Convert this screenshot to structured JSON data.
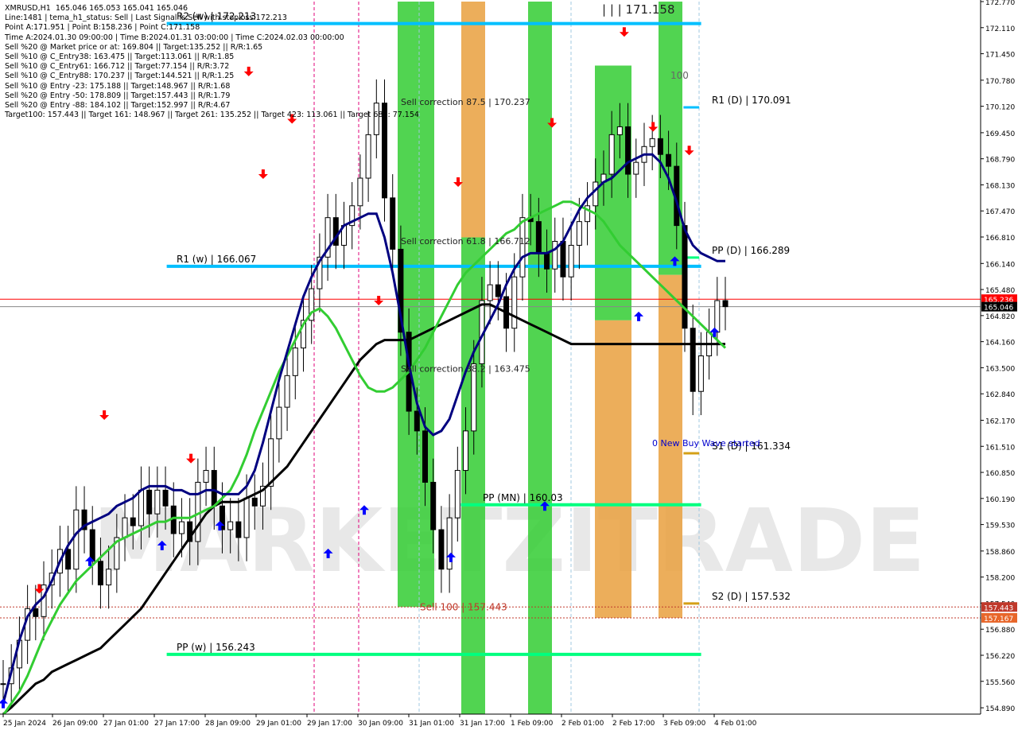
{
  "colors": {
    "background": "#ffffff",
    "axis_text": "#000000",
    "zone_green": "#32cd32",
    "zone_orange": "#e9a03e",
    "level_blue": "#00bfff",
    "level_green": "#00ff7f",
    "ma_fast": "#000080",
    "ma_mid": "#32cd32",
    "ma_slow": "#000000",
    "arrow_up": "#0000ff",
    "arrow_down": "#ff0000",
    "price_line_red": "#ff0000",
    "sell_line": "#c0392b",
    "watermark": "#d9d9d9"
  },
  "info_panel": [
    "XMRUSD,H1  165.046 165.053 165.041 165.046",
    "Line:1481 | tema_h1_status: Sell | Last Signal is:Sell with stoploss:172.213",
    "Point A:171.951 | Point B:158.236 | Point C:171.158",
    "Time A:2024.01.30 09:00:00 | Time B:2024.01.31 03:00:00 | Time C:2024.02.03 00:00:00",
    "Sell %20 @ Market price or at: 169.804 || Target:135.252 || R/R:1.65",
    "Sell %10 @ C_Entry38: 163.475 || Target:113.061 || R/R:1.85",
    "Sell %10 @ C_Entry61: 166.712 || Target:77.154 || R/R:3.72",
    "Sell %10 @ C_Entry88: 170.237 || Target:144.521 || R/R:1.25",
    "Sell %10 @ Entry -23: 175.188 || Target:148.967 || R/R:1.68",
    "Sell %20 @ Entry -50: 178.809 || Target:157.443 || R/R:1.79",
    "Sell %20 @ Entry -88: 184.102 || Target:152.997 || R/R:4.67",
    "Target100: 157.443 || Target 161: 148.967 || Target 261: 135.252 || Target 423: 113.061 || Target 685: 77.154"
  ],
  "watermark": "MARKETZITRADE",
  "chart_data": {
    "type": "candlestick",
    "symbol": "XMRUSD",
    "timeframe": "H1",
    "ylim": [
      154.73,
      172.77
    ],
    "y_ticks": [
      "172.770",
      "172.110",
      "171.450",
      "170.780",
      "170.120",
      "169.450",
      "168.790",
      "168.130",
      "167.470",
      "166.810",
      "166.140",
      "165.480",
      "164.820",
      "164.160",
      "163.500",
      "162.840",
      "162.170",
      "161.510",
      "160.850",
      "160.190",
      "159.530",
      "158.860",
      "158.200",
      "157.540",
      "156.880",
      "156.220",
      "155.560",
      "154.890"
    ],
    "x_ticks": [
      "25 Jan 2024",
      "26 Jan 09:00",
      "27 Jan 01:00",
      "27 Jan 17:00",
      "28 Jan 09:00",
      "29 Jan 01:00",
      "29 Jan 17:00",
      "30 Jan 09:00",
      "31 Jan 01:00",
      "31 Jan 17:00",
      "1 Feb 09:00",
      "2 Feb 01:00",
      "2 Feb 17:00",
      "3 Feb 09:00",
      "4 Feb 01:00"
    ],
    "current_price": "165.046",
    "last_price_tag": "165.236",
    "price_tags": [
      {
        "value": 157.443,
        "label": "157.443"
      },
      {
        "value": 157.167,
        "label": "157.167"
      }
    ],
    "levels": [
      {
        "label": "R2 (w) | 172.213",
        "value": 172.213,
        "color": "level_blue",
        "x_from": 0.17,
        "x_to": 0.715
      },
      {
        "label": "R1 (w) | 166.067",
        "value": 166.067,
        "color": "level_blue",
        "x_from": 0.17,
        "x_to": 0.715
      },
      {
        "label": "PP (w) | 156.243",
        "value": 156.243,
        "color": "level_green",
        "x_from": 0.17,
        "x_to": 0.715
      },
      {
        "label": "PP (MN) | 160.03",
        "value": 160.03,
        "color": "level_green",
        "x_from": 0.47,
        "x_to": 0.715
      },
      {
        "label": "R1 (D) | 170.091",
        "value": 170.091,
        "color": "level_blue",
        "x_from": 0.697,
        "x_to": 0.713
      },
      {
        "label": "PP (D) | 166.289",
        "value": 166.289,
        "color": "level_green",
        "x_from": 0.697,
        "x_to": 0.713
      },
      {
        "label": "S1 (D) | 161.334",
        "value": 161.334,
        "color": "orange",
        "x_from": 0.697,
        "x_to": 0.713
      },
      {
        "label": "S2 (D) | 157.532",
        "value": 157.532,
        "color": "orange",
        "x_from": 0.697,
        "x_to": 0.713
      }
    ],
    "annotations": [
      {
        "text": "Sell correction 87.5 | 170.237",
        "value": 170.237
      },
      {
        "text": "Sell correction 61.8 | 166.712",
        "value": 166.712
      },
      {
        "text": "Sell correction 38.2 | 163.475",
        "value": 163.475
      },
      {
        "text": "Sell 100 | 157.443",
        "value": 157.443
      },
      {
        "text": "0 New Buy Wave started",
        "value": 161.6
      },
      {
        "text": "| | | 171.158",
        "value": 172.55
      },
      {
        "text": "100",
        "value": 170.9
      }
    ],
    "zones": [
      {
        "color": "zone_green",
        "from": 172.77,
        "to": 157.443
      },
      {
        "color": "zone_orange",
        "from": 172.77,
        "to": 166.8
      },
      {
        "color": "zone_green",
        "from": 166.8,
        "to": 154.73
      },
      {
        "color": "zone_green",
        "from": 172.77,
        "to": 154.73
      },
      {
        "color": "zone_green",
        "from": 171.15,
        "to": 164.7
      },
      {
        "color": "zone_orange",
        "from": 164.7,
        "to": 157.167
      },
      {
        "color": "zone_green",
        "from": 172.77,
        "to": 165.85
      },
      {
        "color": "zone_orange",
        "from": 165.85,
        "to": 157.167
      }
    ],
    "prices": [
      155.5,
      155.9,
      156.6,
      157.4,
      157.2,
      158.0,
      158.3,
      158.9,
      158.4,
      159.9,
      159.4,
      158.6,
      158.0,
      158.4,
      159.2,
      159.7,
      159.5,
      160.4,
      159.8,
      160.4,
      160.0,
      159.3,
      159.6,
      159.1,
      160.6,
      160.9,
      160.0,
      159.4,
      159.6,
      159.2,
      160.2,
      160.0,
      160.5,
      161.7,
      162.5,
      163.3,
      164.0,
      164.7,
      165.5,
      166.3,
      167.3,
      166.6,
      167.1,
      167.6,
      168.3,
      169.4,
      170.2,
      167.8,
      166.5,
      164.4,
      162.4,
      161.9,
      160.6,
      159.4,
      158.4,
      159.7,
      160.9,
      161.9,
      163.6,
      165.2,
      165.6,
      165.3,
      164.5,
      165.8,
      167.3,
      167.2,
      166.4,
      166.0,
      166.7,
      165.8,
      166.6,
      167.2,
      167.6,
      168.2,
      168.4,
      169.4,
      169.6,
      168.4,
      168.7,
      169.1,
      169.3,
      168.9,
      168.6,
      167.1,
      164.5,
      162.9,
      163.8,
      164.4,
      165.2,
      165.046
    ],
    "ma_fast": [
      155.0,
      155.8,
      156.6,
      157.2,
      157.5,
      157.7,
      158.1,
      158.6,
      159.0,
      159.3,
      159.5,
      159.6,
      159.7,
      159.8,
      160.0,
      160.1,
      160.2,
      160.4,
      160.5,
      160.5,
      160.5,
      160.4,
      160.4,
      160.3,
      160.3,
      160.4,
      160.4,
      160.3,
      160.3,
      160.3,
      160.5,
      160.9,
      161.6,
      162.4,
      163.2,
      163.9,
      164.6,
      165.3,
      165.8,
      166.2,
      166.5,
      166.8,
      167.1,
      167.2,
      167.3,
      167.4,
      167.4,
      166.8,
      165.9,
      164.8,
      163.6,
      162.6,
      162.0,
      161.8,
      161.9,
      162.2,
      162.8,
      163.4,
      163.9,
      164.3,
      164.7,
      165.1,
      165.6,
      166.0,
      166.3,
      166.4,
      166.4,
      166.4,
      166.5,
      166.7,
      167.1,
      167.5,
      167.8,
      168.0,
      168.2,
      168.3,
      168.5,
      168.7,
      168.8,
      168.9,
      168.9,
      168.7,
      168.3,
      167.7,
      167.0,
      166.6,
      166.4,
      166.3,
      166.2,
      166.2
    ],
    "ma_mid": [
      154.7,
      155.0,
      155.3,
      155.7,
      156.2,
      156.7,
      157.1,
      157.5,
      157.8,
      158.1,
      158.3,
      158.5,
      158.7,
      158.9,
      159.1,
      159.2,
      159.3,
      159.4,
      159.5,
      159.6,
      159.6,
      159.7,
      159.7,
      159.7,
      159.8,
      159.9,
      160.0,
      160.2,
      160.4,
      160.8,
      161.3,
      161.9,
      162.4,
      162.9,
      163.4,
      163.8,
      164.2,
      164.6,
      164.9,
      165.0,
      164.8,
      164.5,
      164.1,
      163.7,
      163.3,
      163.0,
      162.9,
      162.9,
      163.0,
      163.2,
      163.4,
      163.7,
      164.0,
      164.4,
      164.8,
      165.2,
      165.6,
      165.9,
      166.1,
      166.3,
      166.5,
      166.7,
      166.9,
      167.0,
      167.2,
      167.3,
      167.4,
      167.5,
      167.6,
      167.7,
      167.7,
      167.6,
      167.5,
      167.4,
      167.2,
      166.9,
      166.6,
      166.4,
      166.2,
      166.0,
      165.8,
      165.6,
      165.4,
      165.2,
      165.0,
      164.8,
      164.6,
      164.4,
      164.2,
      164.0
    ],
    "ma_slow": [
      154.73,
      154.9,
      155.1,
      155.3,
      155.5,
      155.6,
      155.8,
      155.9,
      156.0,
      156.1,
      156.2,
      156.3,
      156.4,
      156.6,
      156.8,
      157.0,
      157.2,
      157.4,
      157.7,
      158.0,
      158.3,
      158.6,
      158.9,
      159.2,
      159.5,
      159.8,
      160.0,
      160.1,
      160.1,
      160.1,
      160.2,
      160.3,
      160.4,
      160.6,
      160.8,
      161.0,
      161.3,
      161.6,
      161.9,
      162.2,
      162.5,
      162.8,
      163.1,
      163.4,
      163.7,
      163.9,
      164.1,
      164.2,
      164.2,
      164.2,
      164.2,
      164.3,
      164.4,
      164.5,
      164.6,
      164.7,
      164.8,
      164.9,
      165.0,
      165.1,
      165.1,
      165.0,
      164.9,
      164.8,
      164.7,
      164.6,
      164.5,
      164.4,
      164.3,
      164.2,
      164.1,
      164.1,
      164.1,
      164.1,
      164.1,
      164.1,
      164.1,
      164.1,
      164.1,
      164.1,
      164.1,
      164.1,
      164.1,
      164.1,
      164.1,
      164.1,
      164.1,
      164.1,
      164.1,
      164.1
    ],
    "arrows_up": [
      [
        0.0,
        155.0
      ],
      [
        0.12,
        158.6
      ],
      [
        0.22,
        159.0
      ],
      [
        0.3,
        159.5
      ],
      [
        0.45,
        158.8
      ],
      [
        0.5,
        159.9
      ],
      [
        0.62,
        158.7
      ],
      [
        0.75,
        160.0
      ],
      [
        0.88,
        164.8
      ],
      [
        0.93,
        166.2
      ],
      [
        0.985,
        164.4
      ]
    ],
    "arrows_down": [
      [
        0.05,
        157.9
      ],
      [
        0.14,
        162.3
      ],
      [
        0.26,
        161.2
      ],
      [
        0.34,
        171.0
      ],
      [
        0.36,
        168.4
      ],
      [
        0.4,
        169.8
      ],
      [
        0.52,
        165.2
      ],
      [
        0.63,
        168.2
      ],
      [
        0.76,
        169.7
      ],
      [
        0.86,
        172.0
      ],
      [
        0.9,
        169.6
      ],
      [
        0.95,
        169.0
      ]
    ]
  }
}
